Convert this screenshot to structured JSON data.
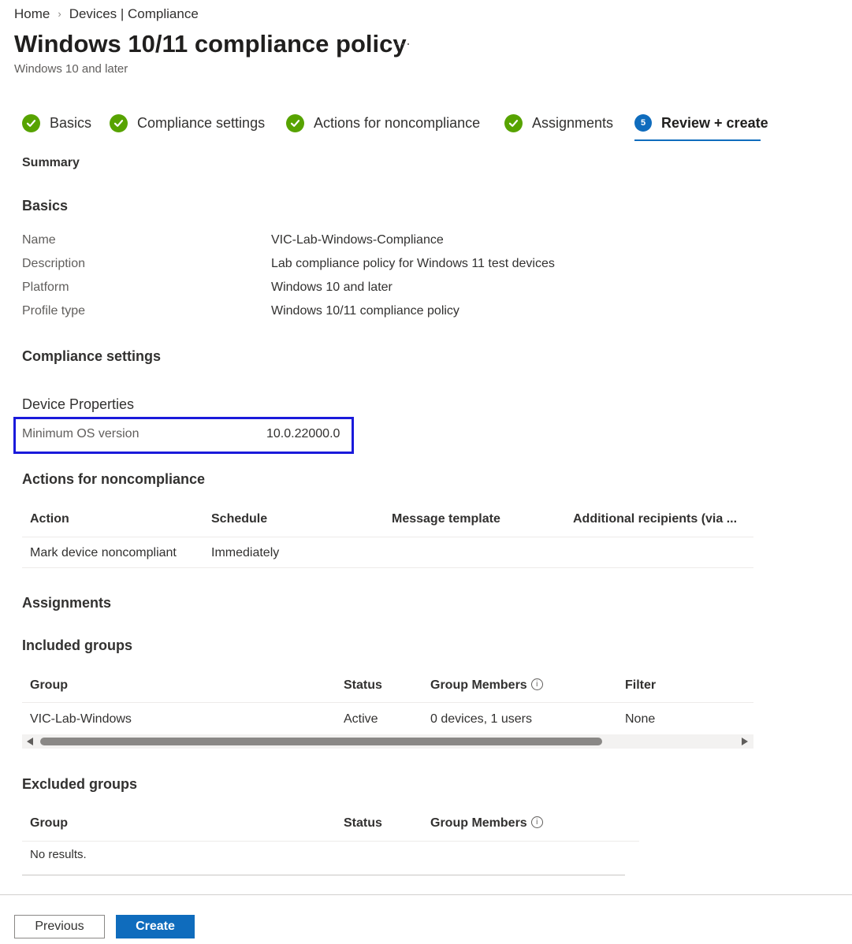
{
  "breadcrumb": {
    "home": "Home",
    "current": "Devices | Compliance"
  },
  "header": {
    "title": "Windows 10/11 compliance policy",
    "more": "···",
    "subtitle": "Windows 10 and later"
  },
  "steps": [
    {
      "label": "Basics",
      "state": "done"
    },
    {
      "label": "Compliance settings",
      "state": "done"
    },
    {
      "label": "Actions for noncompliance",
      "state": "done"
    },
    {
      "label": "Assignments",
      "state": "done"
    },
    {
      "label": "Review + create",
      "state": "active",
      "number": "5"
    }
  ],
  "summary_label": "Summary",
  "basics": {
    "heading": "Basics",
    "rows": [
      {
        "label": "Name",
        "value": "VIC-Lab-Windows-Compliance"
      },
      {
        "label": "Description",
        "value": "Lab compliance policy for Windows 11 test devices"
      },
      {
        "label": "Platform",
        "value": "Windows 10 and later"
      },
      {
        "label": "Profile type",
        "value": "Windows 10/11 compliance policy"
      }
    ]
  },
  "compliance": {
    "heading": "Compliance settings",
    "subheading": "Device Properties",
    "setting_label": "Minimum OS version",
    "setting_value": "10.0.22000.0",
    "highlight_color": "#1a1adb"
  },
  "actions": {
    "heading": "Actions for noncompliance",
    "columns": [
      "Action",
      "Schedule",
      "Message template",
      "Additional recipients (via ..."
    ],
    "rows": [
      [
        "Mark device noncompliant",
        "Immediately",
        "",
        ""
      ]
    ]
  },
  "assignments": {
    "heading": "Assignments",
    "included": {
      "heading": "Included groups",
      "columns": [
        "Group",
        "Status",
        "Group Members",
        "Filter"
      ],
      "rows": [
        [
          "VIC-Lab-Windows",
          "Active",
          "0 devices, 1 users",
          "None"
        ]
      ]
    },
    "excluded": {
      "heading": "Excluded groups",
      "columns": [
        "Group",
        "Status",
        "Group Members"
      ],
      "empty_text": "No results."
    }
  },
  "footer": {
    "previous_label": "Previous",
    "create_label": "Create"
  },
  "colors": {
    "accent": "#0f6cbd",
    "success": "#57a300"
  }
}
